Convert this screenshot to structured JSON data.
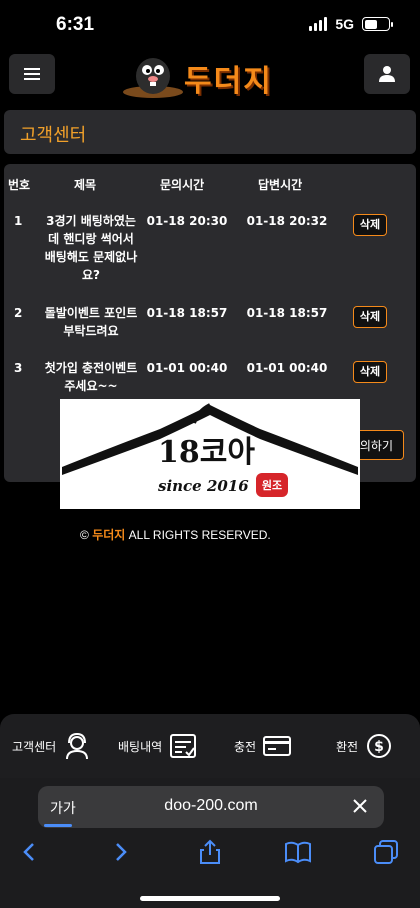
{
  "status": {
    "time": "6:31",
    "network": "5G"
  },
  "header": {
    "logo_text": "두더지"
  },
  "page_title": "고객센터",
  "table": {
    "columns": [
      "번호",
      "제목",
      "문의시간",
      "답변시간"
    ],
    "rows": [
      {
        "num": "1",
        "title": "3경기 배팅하였는데 핸디랑 썩어서 배팅해도 문제없나요?",
        "asked": "01-18 20:30",
        "answered": "01-18 20:32",
        "action": "삭제"
      },
      {
        "num": "2",
        "title": "돌발이벤트 포인트 부탁드려요",
        "asked": "01-18 18:57",
        "answered": "01-18 18:57",
        "action": "삭제"
      },
      {
        "num": "3",
        "title": "첫가입 충전이벤트주세요~~",
        "asked": "01-01 00:40",
        "answered": "01-01 00:40",
        "action": "삭제"
      }
    ],
    "inquiry_button": "의하기"
  },
  "overlay": {
    "brand": "18코아",
    "since": "since 2016",
    "badge": "원조"
  },
  "footer": {
    "symbol": "©",
    "brand": "두더지",
    "rights": "ALL RIGHTS RESERVED."
  },
  "bottom_nav": [
    {
      "label": "고객센터",
      "icon": "headset-icon"
    },
    {
      "label": "배팅내역",
      "icon": "checklist-icon"
    },
    {
      "label": "충전",
      "icon": "card-icon"
    },
    {
      "label": "환전",
      "icon": "dollar-exchange-icon"
    }
  ],
  "browser": {
    "aa": "가가",
    "url": "doo-200.com"
  },
  "colors": {
    "accent": "#f58a1a",
    "panel": "#2b2b2e",
    "title": "#f0a02a"
  }
}
